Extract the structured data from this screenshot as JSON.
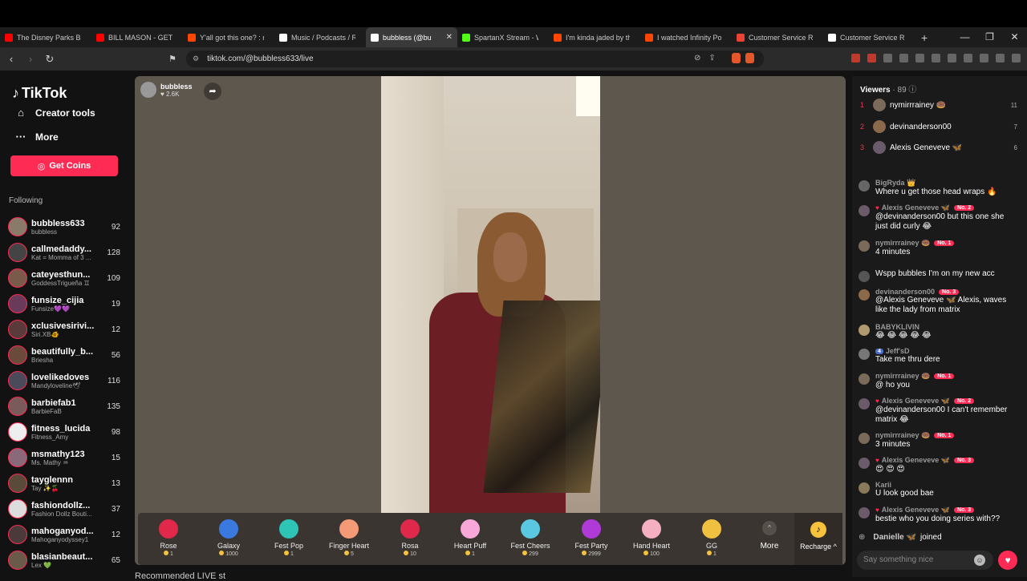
{
  "browser": {
    "tabs": [
      {
        "label": "The Disney Parks Back",
        "color": "#ff0000"
      },
      {
        "label": "BILL MASON - GETTIN",
        "color": "#ff0000"
      },
      {
        "label": "Y'all got this one? : r/a",
        "color": "#ff4500"
      },
      {
        "label": "Music / Podcasts / Rad",
        "color": "#ffffff"
      },
      {
        "label": "bubbless (@bu",
        "color": "#ffffff",
        "active": true
      },
      {
        "label": "SpartanX Stream - Wat",
        "color": "#53fc18"
      },
      {
        "label": "I'm kinda jaded by the",
        "color": "#ff4500"
      },
      {
        "label": "I watched Infinity Pool",
        "color": "#ff4500"
      },
      {
        "label": "Customer Service Rep",
        "color": "#ea4335"
      },
      {
        "label": "Customer Service Rep",
        "color": "#ffffff"
      }
    ],
    "new_tab": "+",
    "url": "tiktok.com/@bubbless633/live"
  },
  "sidebar": {
    "logo": "TikTok",
    "creator_tools": "Creator tools",
    "more": "More",
    "get_coins": "Get Coins",
    "following_label": "Following",
    "following": [
      {
        "name": "bubbless633",
        "sub": "bubbless",
        "count": "92",
        "color": "#8a7a6a"
      },
      {
        "name": "callmedaddy...",
        "sub": "Kat = Momma of 3 ...",
        "count": "128",
        "color": "#444"
      },
      {
        "name": "cateyesthun...",
        "sub": "GoddessTrigueña ♊",
        "count": "109",
        "color": "#7a5a4a"
      },
      {
        "name": "funsize_cijia",
        "sub": "Funsize💜💜",
        "count": "19",
        "color": "#6a3a5a"
      },
      {
        "name": "xclusivesirivi...",
        "sub": "Siri.XB🐠",
        "count": "12",
        "color": "#5a3a3a"
      },
      {
        "name": "beautifully_b...",
        "sub": "Briesha",
        "count": "56",
        "color": "#6a4a3a"
      },
      {
        "name": "lovelikedoves",
        "sub": "Mandyloveline🕊",
        "count": "116",
        "color": "#4a4a5a"
      },
      {
        "name": "barbiefab1",
        "sub": "BarbieFaB",
        "count": "135",
        "color": "#7a5a5a"
      },
      {
        "name": "fitness_lucida",
        "sub": "Fitness_Amy",
        "count": "98",
        "color": "#eee"
      },
      {
        "name": "msmathy123",
        "sub": "Ms. Mathy ♒",
        "count": "15",
        "color": "#8a6a7a"
      },
      {
        "name": "tayglennn",
        "sub": "Tay ✨🍒",
        "count": "13",
        "color": "#5a4a3a"
      },
      {
        "name": "fashiondollz...",
        "sub": "Fashion Dollz Bouti...",
        "count": "37",
        "color": "#ddd"
      },
      {
        "name": "mahoganyod...",
        "sub": "Mahoganyodyssey1",
        "count": "12",
        "color": "#4a3a3a"
      },
      {
        "name": "blasianbeaut...",
        "sub": "Lex 💚",
        "count": "65",
        "color": "#6a5a4a"
      }
    ]
  },
  "live": {
    "host_name": "bubbless",
    "host_likes": "♥ 2.6K",
    "gifts": [
      {
        "name": "Rose",
        "price": "1",
        "color": "#e0284a"
      },
      {
        "name": "Galaxy",
        "price": "1000",
        "color": "#3a7ae0"
      },
      {
        "name": "Fest Pop",
        "price": "1",
        "color": "#2ec4b6"
      },
      {
        "name": "Finger Heart",
        "price": "5",
        "color": "#f59a76"
      },
      {
        "name": "Rosa",
        "price": "10",
        "color": "#e0284a"
      },
      {
        "name": "Heart Puff",
        "price": "1",
        "color": "#f7a8d8"
      },
      {
        "name": "Fest Cheers",
        "price": "299",
        "color": "#5ac8e0"
      },
      {
        "name": "Fest Party",
        "price": "2999",
        "color": "#b03ad8"
      },
      {
        "name": "Hand Heart",
        "price": "100",
        "color": "#f4b0c0"
      },
      {
        "name": "GG",
        "price": "1",
        "color": "#f0c040"
      }
    ],
    "more": "More",
    "recharge": "Recharge ^",
    "below_text": "Recommended LIVE st"
  },
  "viewers": {
    "title": "Viewers",
    "count": "89",
    "top": [
      {
        "rank": "1",
        "name": "nymirrrainey 🍩",
        "count": "11",
        "color": "#7a6a5a"
      },
      {
        "rank": "2",
        "name": "devinanderson00",
        "count": "7",
        "color": "#8a6a4a"
      },
      {
        "rank": "3",
        "name": "Alexis Geneveve 🦋",
        "count": "6",
        "color": "#6a5a6a"
      }
    ]
  },
  "chat": [
    {
      "user": "BigRyda 👑",
      "text": "Where u get those head wraps 🔥",
      "color": "#666"
    },
    {
      "user": "Alexis Geneveve 🦋",
      "badge": "No. 2",
      "heart": true,
      "text": "@devinanderson00 but this one she just did curly 😂",
      "color": "#6a5a6a"
    },
    {
      "user": "nymirrrainey 🍩",
      "badge": "No. 1",
      "text": "4 minutes",
      "color": "#7a6a5a"
    },
    {
      "user": "",
      "text": "Wspp bubbles I'm on my new acc",
      "color": "#555"
    },
    {
      "user": "devinanderson00",
      "badge": "No. 3",
      "text": "@Alexis Geneveve 🦋 Alexis, waves like the lady from matrix",
      "color": "#8a6a4a"
    },
    {
      "user": "BABYKLIVIN",
      "text": "😂 😂 😂 😂 😂",
      "color": "#b09a70"
    },
    {
      "user": "Jeff'sD",
      "lvl": "4",
      "text": "Take me thru dere",
      "color": "#777"
    },
    {
      "user": "nymirrrainey 🍩",
      "badge": "No. 1",
      "text": "@ ho you",
      "color": "#7a6a5a"
    },
    {
      "user": "Alexis Geneveve 🦋",
      "badge": "No. 2",
      "heart": true,
      "text": "@devinanderson00 I can't remember matrix 😂",
      "color": "#6a5a6a"
    },
    {
      "user": "nymirrrainey 🍩",
      "badge": "No. 1",
      "text": "3 minutes",
      "color": "#7a6a5a"
    },
    {
      "user": "Alexis Geneveve 🦋",
      "badge": "No. 3",
      "heart": true,
      "text": "😍 😍 😍",
      "color": "#6a5a6a"
    },
    {
      "user": "Karii",
      "text": "U look good bae",
      "color": "#8a7a5a"
    },
    {
      "user": "Alexis Geneveve 🦋",
      "badge": "No. 3",
      "heart": true,
      "text": "bestie who you doing series with??",
      "color": "#6a5a6a"
    }
  ],
  "joined": {
    "name": "Danielle 🦋",
    "text": "joined"
  },
  "chat_input": {
    "placeholder": "Say something nice"
  }
}
